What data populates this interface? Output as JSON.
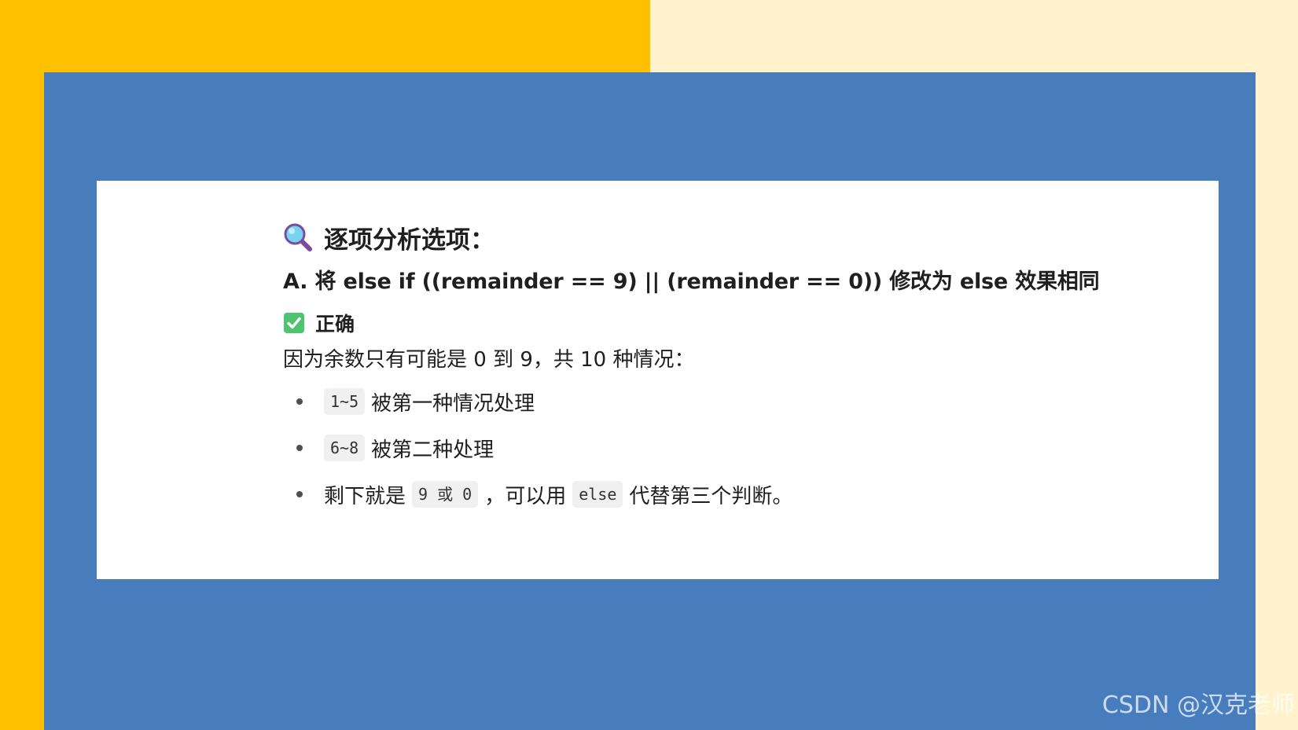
{
  "slide": {
    "colors": {
      "left_yellow": "#ffc000",
      "right_cream": "#fff2cc",
      "blue_panel": "#487dbd",
      "card": "#ffffff"
    }
  },
  "content": {
    "heading": {
      "icon": "magnifying-glass-icon",
      "text": "逐项分析选项："
    },
    "option_a": "A. 将 else if ((remainder == 9) || (remainder == 0)) 修改为 else 效果相同",
    "status": {
      "icon": "check-mark-button-icon",
      "text": "正确"
    },
    "explanation": "因为余数只有可能是 0 到 9，共 10 种情况：",
    "bullets": [
      {
        "code": "1~5",
        "text": "被第一种情况处理"
      },
      {
        "code": "6~8",
        "text": "被第二种处理"
      },
      {
        "prefix": "剩下就是",
        "code1": "9 或 0",
        "middle": "，可以用",
        "code2": "else",
        "suffix": "代替第三个判断。"
      }
    ]
  },
  "watermark": "CSDN @汉克老师"
}
